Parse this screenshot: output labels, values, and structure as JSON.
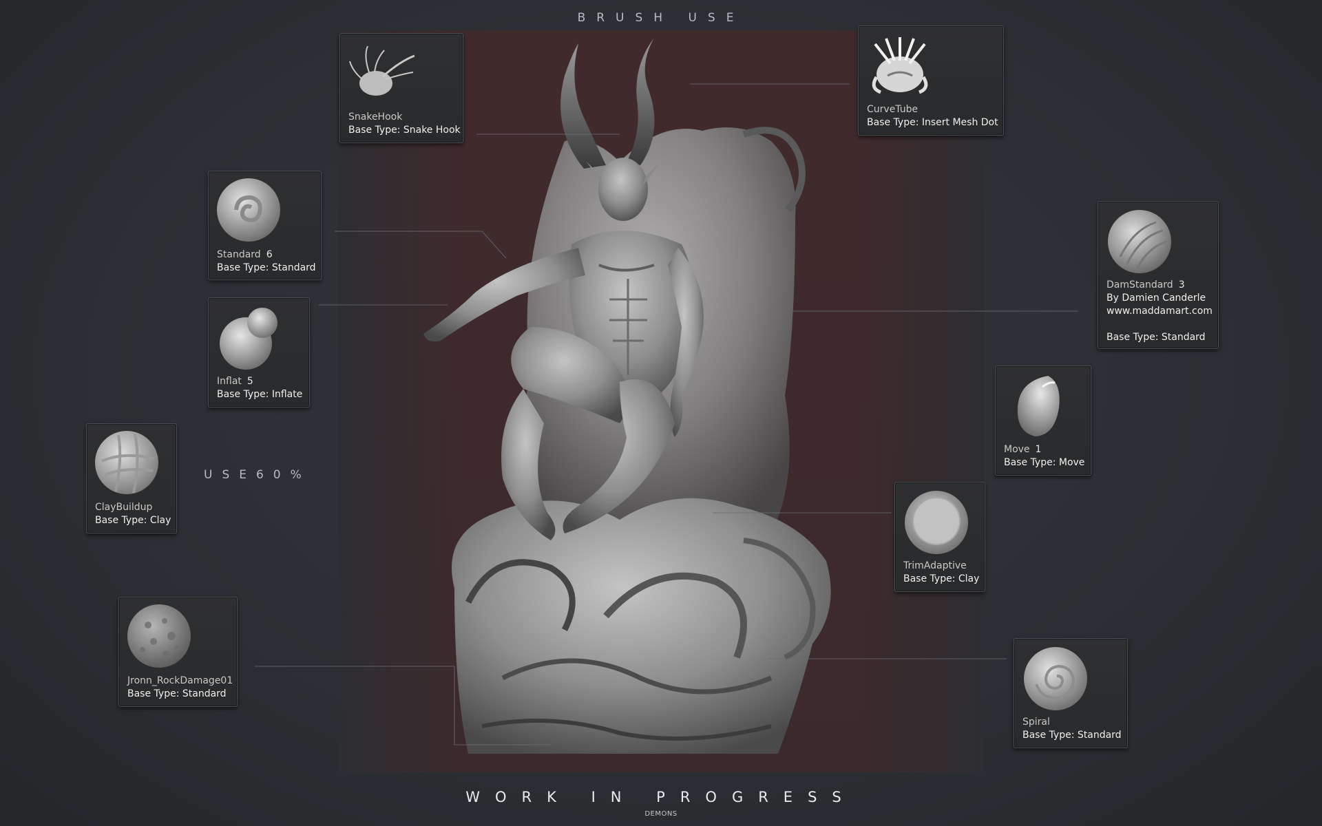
{
  "header": {
    "title": "BRUSH USE"
  },
  "footer": {
    "title": "WORK IN PROGRESS",
    "subtitle": "DEMONS"
  },
  "side_note": "USE60%",
  "brushes": [
    {
      "id": "snakehook",
      "name": "SnakeHook",
      "count": "",
      "lines": [
        "Base Type: Snake Hook"
      ],
      "icon": "snakehook-brush-icon"
    },
    {
      "id": "curvetube",
      "name": "CurveTube",
      "count": "",
      "lines": [
        "Base Type: Insert Mesh Dot"
      ],
      "icon": "curvetube-brush-icon"
    },
    {
      "id": "standard",
      "name": "Standard",
      "count": "6",
      "lines": [
        "Base Type: Standard"
      ],
      "icon": "standard-brush-icon"
    },
    {
      "id": "damstandard",
      "name": "DamStandard",
      "count": "3",
      "lines": [
        "By Damien Canderle",
        "www.maddamart.com",
        "",
        "Base Type: Standard"
      ],
      "icon": "damstandard-brush-icon"
    },
    {
      "id": "inflat",
      "name": "Inflat",
      "count": "5",
      "lines": [
        "Base Type: Inflate"
      ],
      "icon": "inflat-brush-icon"
    },
    {
      "id": "move",
      "name": "Move",
      "count": "1",
      "lines": [
        "Base Type: Move"
      ],
      "icon": "move-brush-icon"
    },
    {
      "id": "claybuildup",
      "name": "ClayBuildup",
      "count": "",
      "lines": [
        "Base Type: Clay"
      ],
      "icon": "claybuildup-brush-icon"
    },
    {
      "id": "trimadaptive",
      "name": "TrimAdaptive",
      "count": "",
      "lines": [
        "Base Type: Clay"
      ],
      "icon": "trimadaptive-brush-icon"
    },
    {
      "id": "rockdamage",
      "name": "Jronn_RockDamage01",
      "count": "",
      "lines": [
        "Base Type: Standard"
      ],
      "icon": "rockdamage-brush-icon"
    },
    {
      "id": "spiral",
      "name": "Spiral",
      "count": "",
      "lines": [
        "Base Type: Standard"
      ],
      "icon": "spiral-brush-icon"
    }
  ],
  "colors": {
    "background": "#2b2e32",
    "stage": "#3e2a2c",
    "card": "#2b2c2e",
    "clay": "#8c8c8c"
  }
}
